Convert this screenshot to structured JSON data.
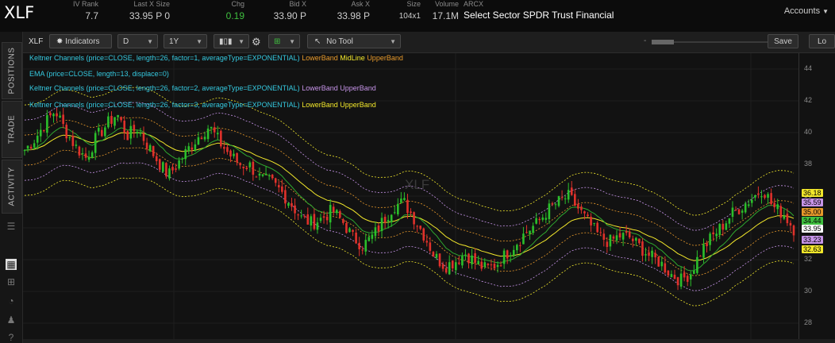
{
  "header": {
    "symbol": "XLF",
    "iv_rank": {
      "label": "IV Rank",
      "value": "7.7"
    },
    "last_x": {
      "label": "Last X Size",
      "value": "33.95 P 0"
    },
    "chg": {
      "label": "Chg",
      "value": "0.19"
    },
    "bid": {
      "label": "Bid X",
      "value": "33.90 P"
    },
    "ask": {
      "label": "Ask X",
      "value": "33.98 P"
    },
    "size": {
      "label": "Size",
      "value": "104x1"
    },
    "volume": {
      "label": "Volume",
      "value": "17.1M"
    },
    "exchange": "ARCX",
    "name": "Select Sector SPDR Trust Financial",
    "accounts": "Accounts"
  },
  "side_tabs": [
    "POSITIONS",
    "TRADE",
    "ACTIVITY"
  ],
  "side_icons": [
    "list-icon",
    "chart-icon",
    "grid-icon",
    "gauge-icon",
    "people-icon",
    "help-icon"
  ],
  "toolbar": {
    "symbol": "XLF",
    "indicators": "Indicators",
    "interval": "D",
    "range": "1Y",
    "tool": "No Tool",
    "zoom_minus": "-",
    "zoom_plus": "+",
    "save": "Save",
    "load": "Lo"
  },
  "studies": [
    {
      "main": "Keltner Channels (price=CLOSE, length=26, factor=1, averageType=EXPONENTIAL)",
      "parts": [
        {
          "t": "LowerBand",
          "c": "#e89a2b"
        },
        {
          "t": "MidLine",
          "c": "#f2e72b"
        },
        {
          "t": "UpperBand",
          "c": "#e89a2b"
        }
      ]
    },
    {
      "main": "EMA (price=CLOSE, length=13, displace=0)",
      "parts": []
    },
    {
      "main": "Keltner Channels (price=CLOSE, length=26, factor=2, averageType=EXPONENTIAL)",
      "parts": [
        {
          "t": "LowerBand",
          "c": "#c694e8"
        },
        {
          "t": "UpperBand",
          "c": "#c694e8"
        }
      ]
    },
    {
      "main": "Keltner Channels (price=CLOSE, length=26, factor=3, averageType=EXPONENTIAL)",
      "parts": [
        {
          "t": "LowerBand",
          "c": "#f2e72b"
        },
        {
          "t": "UpperBand",
          "c": "#f2e72b"
        }
      ]
    }
  ],
  "watermark": "XLF",
  "chart_data": {
    "type": "candlestick",
    "ylim": [
      27,
      45
    ],
    "yticks": [
      28,
      30,
      32,
      34,
      36,
      38,
      40,
      42,
      44
    ],
    "closes": [
      38.9,
      39.6,
      40.6,
      41.4,
      40.1,
      39.1,
      38.4,
      39.7,
      40.5,
      41.2,
      39.8,
      40.3,
      39.2,
      38.2,
      37.3,
      38.1,
      39.0,
      39.8,
      40.4,
      39.4,
      38.6,
      38.0,
      37.9,
      37.1,
      36.9,
      36.3,
      35.5,
      34.6,
      34.3,
      34.6,
      35.1,
      34.4,
      33.4,
      32.9,
      33.5,
      34.5,
      35.4,
      35.6,
      34.6,
      33.5,
      32.2,
      31.6,
      31.9,
      32.4,
      31.8,
      31.4,
      31.7,
      32.4,
      33.1,
      33.8,
      34.3,
      35.1,
      35.6,
      36.0,
      35.2,
      34.3,
      33.5,
      33.1,
      33.5,
      33.4,
      32.8,
      32.2,
      31.8,
      31.1,
      30.7,
      31.2,
      32.6,
      33.4,
      34.1,
      34.9,
      35.4,
      35.9,
      36.5,
      35.3,
      34.9,
      33.95
    ],
    "value_tags": [
      {
        "v": "36.18",
        "c": "#f2e72b"
      },
      {
        "v": "35.59",
        "c": "#c694e8"
      },
      {
        "v": "35.00",
        "c": "#e89a2b"
      },
      {
        "v": "34.44",
        "c": "#3fbf3f"
      },
      {
        "v": "33.95",
        "c": "#ffffff"
      },
      {
        "v": "33.23",
        "c": "#c694e8"
      },
      {
        "v": "32.63",
        "c": "#f2e72b"
      }
    ]
  }
}
